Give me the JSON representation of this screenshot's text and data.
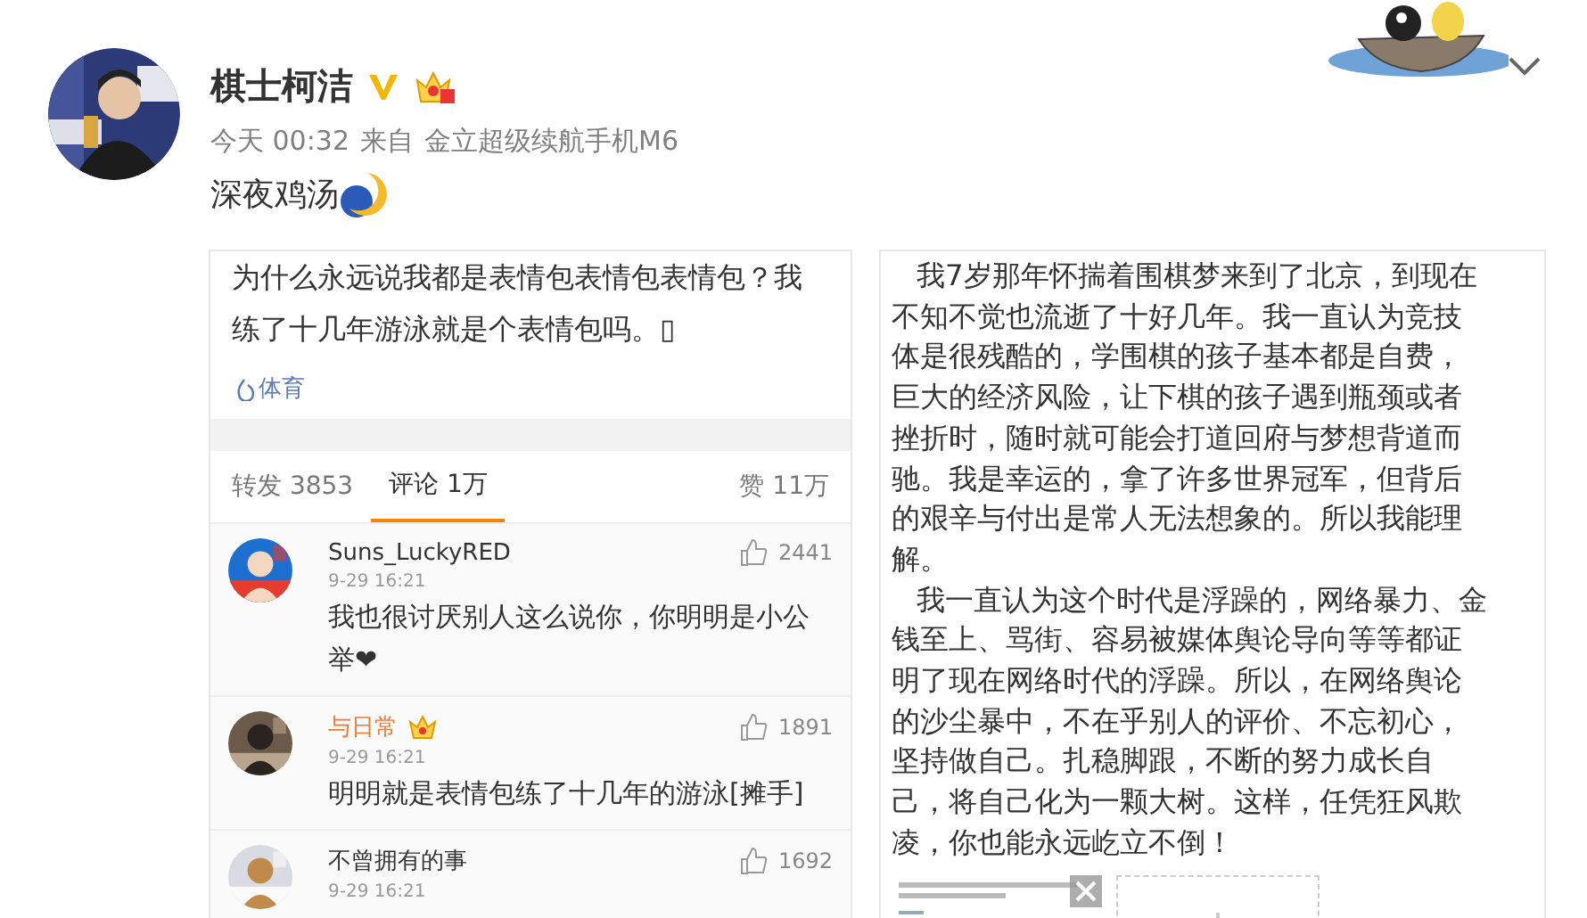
{
  "post": {
    "author": "棋士柯洁",
    "verified": true,
    "time": "今天 00:32",
    "source_prefix": "来自",
    "source": "金立超级续航手机M6",
    "text": "深夜鸡汤"
  },
  "left_screenshot": {
    "text": "为什么永远说我都是表情包表情包表情包？我练了十几年游泳就是个表情包吗。▯",
    "tag": "体育",
    "tabs": [
      {
        "label": "转发 3853",
        "selected": false
      },
      {
        "label": "评论 1万",
        "selected": true
      },
      {
        "label": "赞 11万",
        "selected": false
      }
    ],
    "comments": [
      {
        "name": "Suns_LuckyRED",
        "vip": false,
        "likes": "2441",
        "date": "9-29 16:21",
        "text": "我也很讨厌别人这么说你，你明明是小公举❤"
      },
      {
        "name": "与日常",
        "vip": true,
        "likes": "1891",
        "date": "9-29 16:21",
        "text": "明明就是表情包练了十几年的游泳[摊手]"
      },
      {
        "name": "不曾拥有的事",
        "vip": false,
        "likes": "1692",
        "date": "9-29 16:21"
      }
    ]
  },
  "right_screenshot": {
    "paragraphs": [
      [
        "我7岁那年怀揣着围棋梦来到了北京，到现在",
        "不知不觉也流逝了十好几年。我一直认为竞技",
        "体是很残酷的，学围棋的孩子基本都是自费，",
        "巨大的经济风险，让下棋的孩子遇到瓶颈或者",
        "挫折时，随时就可能会打道回府与梦想背道而",
        "驰。我是幸运的，拿了许多世界冠军，但背后",
        "的艰辛与付出是常人无法想象的。所以我能理",
        "解。"
      ],
      [
        "我一直认为这个时代是浮躁的，网络暴力、金",
        "钱至上、骂街、容易被媒体舆论导向等等都证",
        "明了现在网络时代的浮躁。所以，在网络舆论",
        "的沙尘暴中，不在乎别人的评价、不忘初心，",
        "坚持做自己。扎稳脚跟，不断的努力成长自",
        "己，将自己化为一颗大树。这样，任凭狂风欺",
        "凌，你也能永远屹立不倒！"
      ]
    ]
  }
}
